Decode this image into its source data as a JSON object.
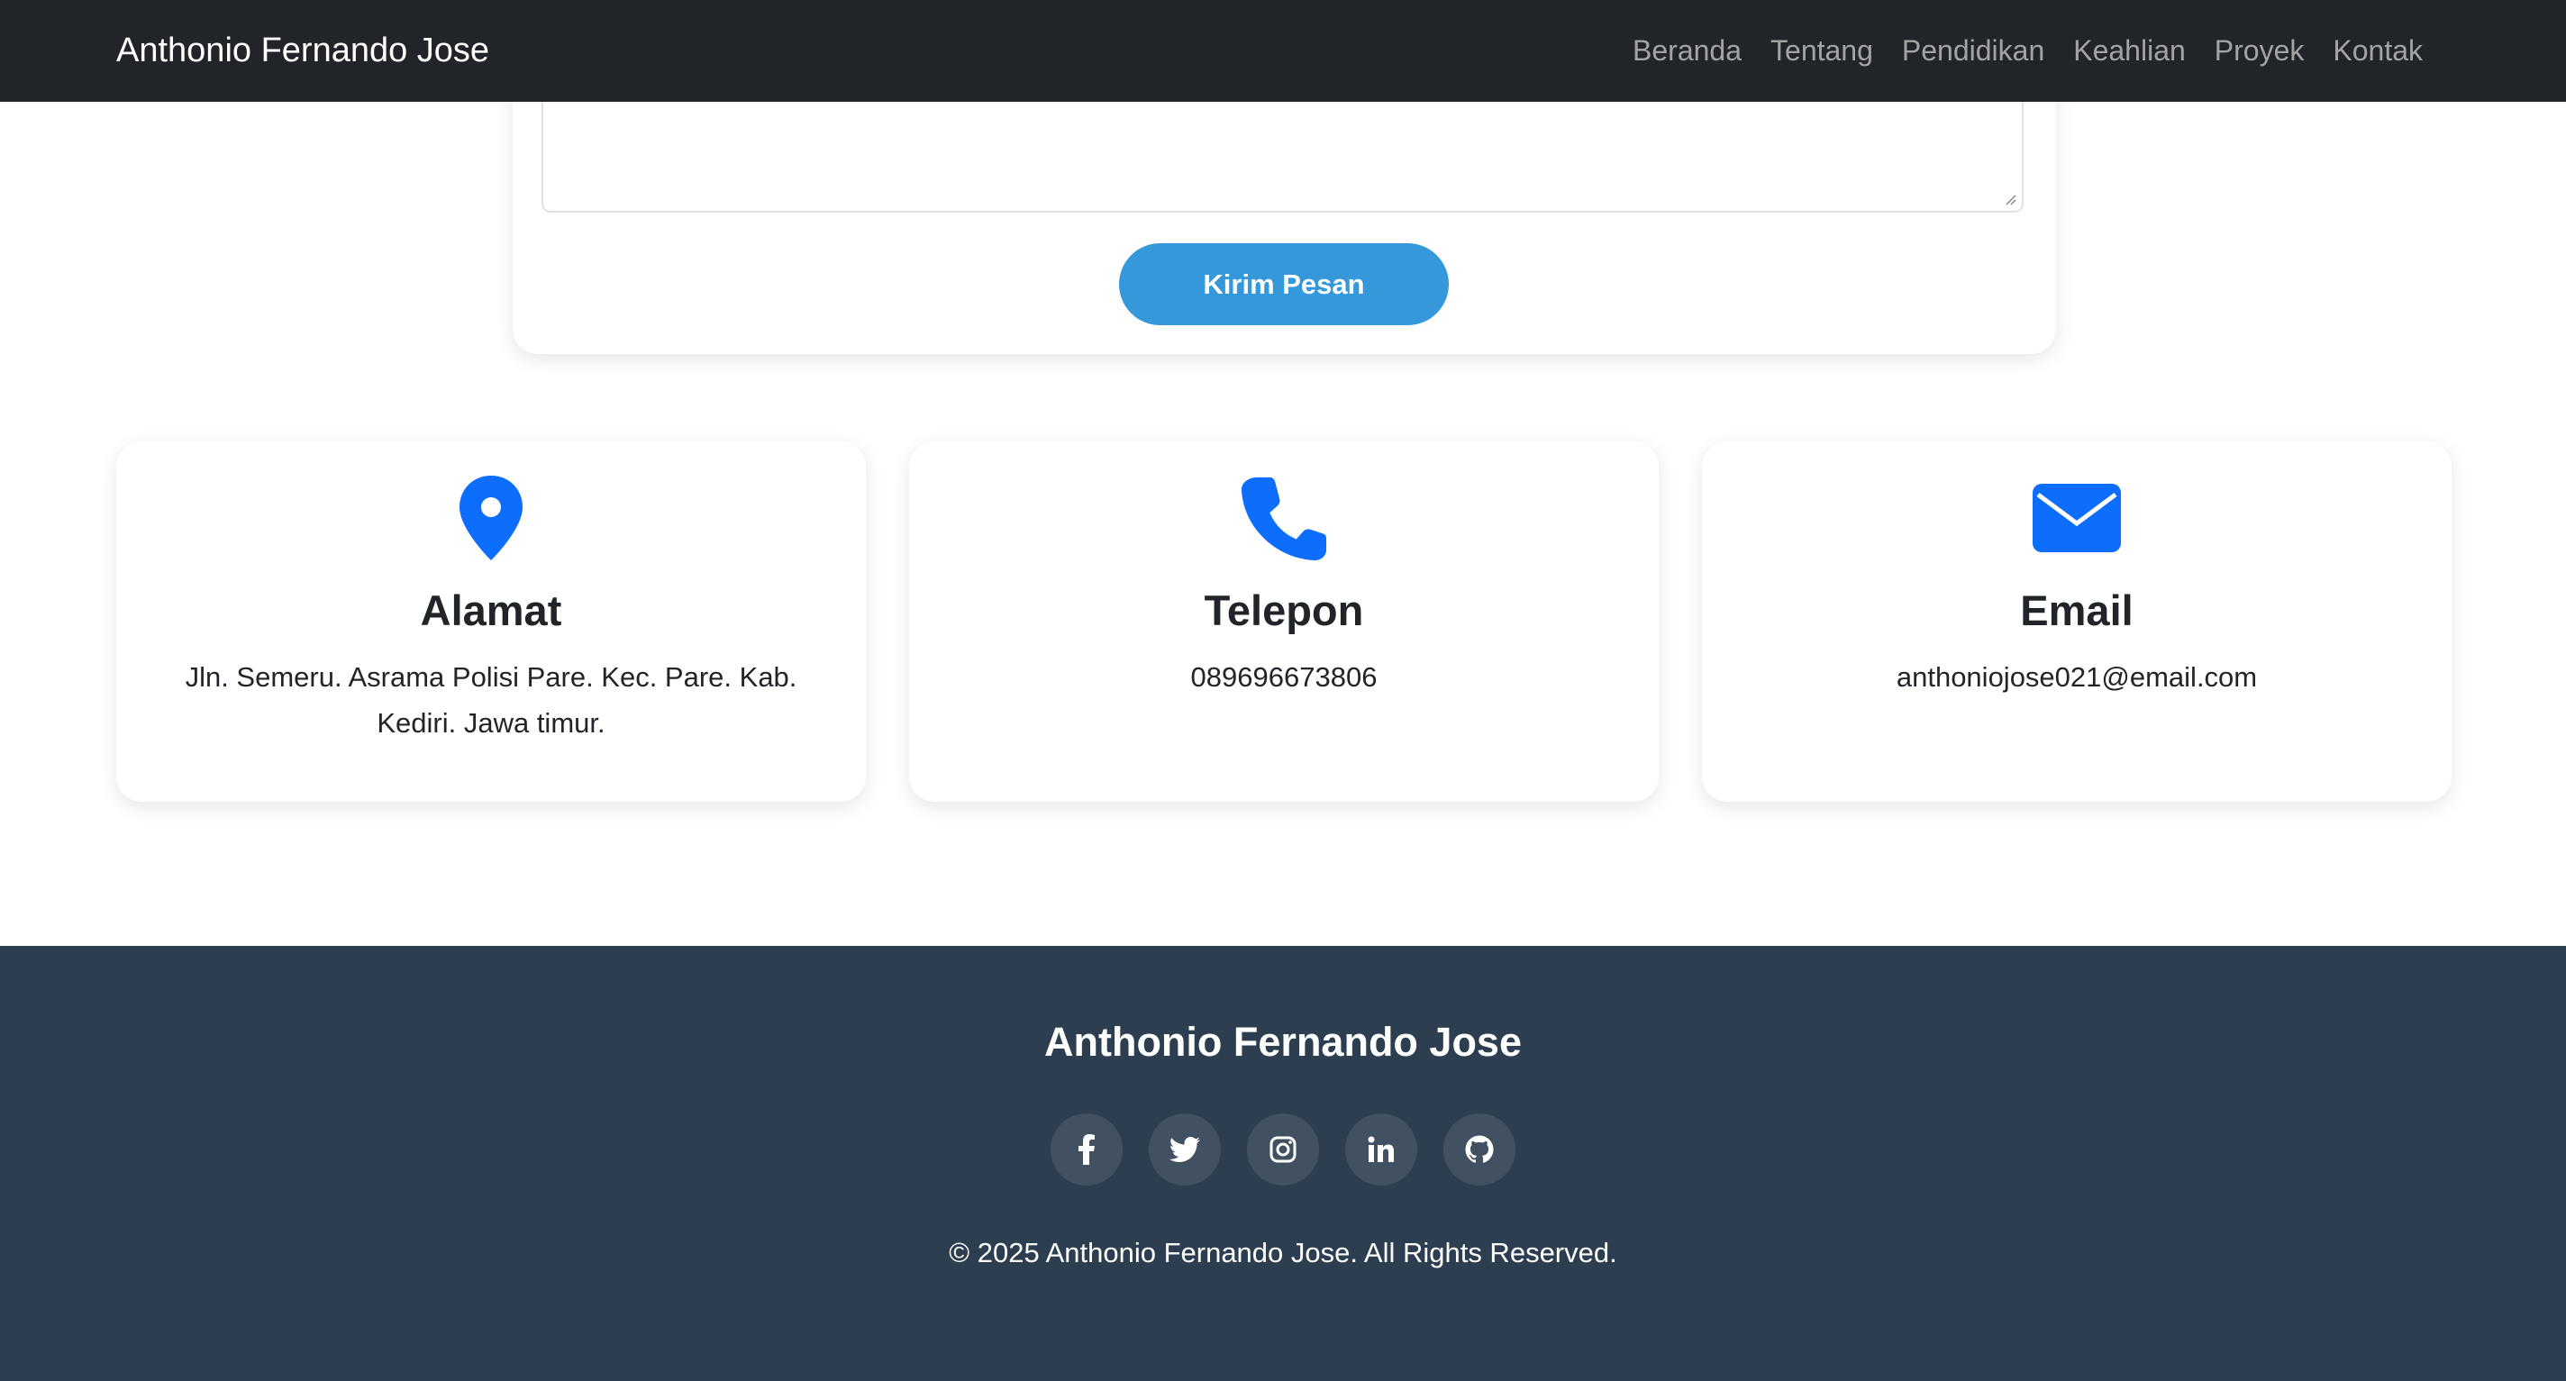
{
  "navbar": {
    "brand": "Anthonio Fernando Jose",
    "links": [
      "Beranda",
      "Tentang",
      "Pendidikan",
      "Keahlian",
      "Proyek",
      "Kontak"
    ]
  },
  "contact_form": {
    "submit_label": "Kirim Pesan"
  },
  "info_cards": [
    {
      "icon": "map-pin-icon",
      "title": "Alamat",
      "text": "Jln. Semeru. Asrama Polisi Pare. Kec. Pare. Kab. Kediri. Jawa timur."
    },
    {
      "icon": "phone-icon",
      "title": "Telepon",
      "text": "089696673806"
    },
    {
      "icon": "envelope-icon",
      "title": "Email",
      "text": "anthoniojose021@email.com"
    }
  ],
  "footer": {
    "name": "Anthonio Fernando Jose",
    "social": [
      "facebook-icon",
      "twitter-icon",
      "instagram-icon",
      "linkedin-icon",
      "github-icon"
    ],
    "copyright": "© 2025 Anthonio Fernando Jose. All Rights Reserved."
  },
  "colors": {
    "navbar_bg": "#212529",
    "accent_button": "#3498db",
    "icon_blue": "#0d6efd",
    "footer_bg": "#2c3e50"
  }
}
